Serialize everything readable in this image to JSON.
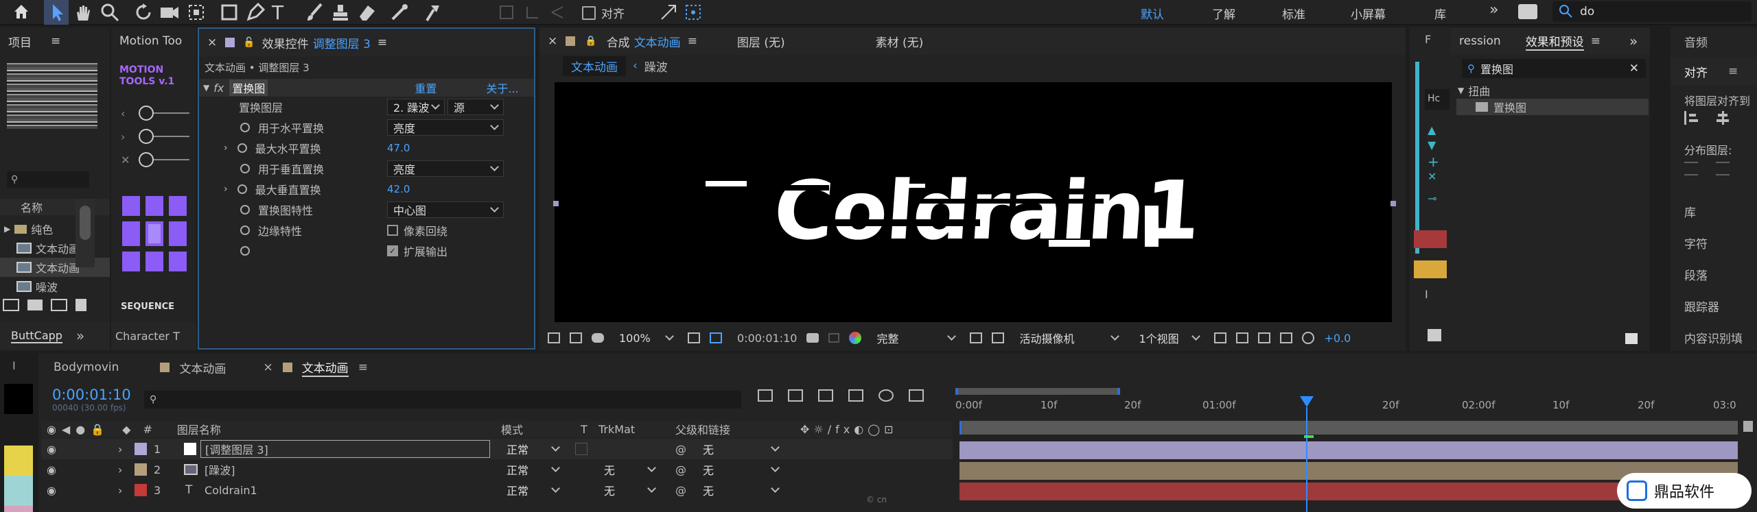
{
  "toolbar": {
    "align_checkbox": "对齐",
    "workspaces": [
      "默认",
      "了解",
      "标准",
      "小屏幕",
      "库"
    ],
    "search_value": "do",
    "overflow": "»"
  },
  "project": {
    "title": "项目",
    "motion_title": "Motion Too",
    "motion_logo_line1": "MOTION",
    "motion_logo_line2": "TOOLS v.1",
    "sequence_label": "SEQUENCE",
    "name_column": "名称",
    "items": [
      {
        "label": "纯色"
      },
      {
        "label": "文本动画"
      },
      {
        "label": "文本动画"
      },
      {
        "label": "噪波"
      }
    ],
    "bottom_tabs": [
      "ButtCapp",
      "Character T"
    ]
  },
  "effect_controls": {
    "title_prefix": "效果控件",
    "title_layer": "调整图层 3",
    "subtitle": "文本动画 • 调整图层 3",
    "fx_label": "fx",
    "effect_name": "置换图",
    "reset": "重置",
    "about": "关于...",
    "props": [
      {
        "label": "置换图层",
        "value1": "2. 躁波",
        "value2": "源"
      },
      {
        "label": "用于水平置换",
        "value": "亮度"
      },
      {
        "label": "最大水平置换",
        "value": "47.0"
      },
      {
        "label": "用于垂直置换",
        "value": "亮度"
      },
      {
        "label": "最大垂直置换",
        "value": "42.0"
      },
      {
        "label": "置换图特性",
        "value": "中心图"
      },
      {
        "label": "边缘特性",
        "checkbox": "像素回绕"
      },
      {
        "label": "",
        "checkbox": "扩展输出"
      }
    ]
  },
  "composition": {
    "tab_prefix": "合成",
    "tab_name": "文本动画",
    "layer_tab": "图层  (无)",
    "footage_tab": "素材  (无)",
    "breadcrumb_active": "文本动画",
    "breadcrumb_next": "躁波",
    "canvas_text": "Coldrain1",
    "zoom": "100%",
    "timecode": "0:00:01:10",
    "quality": "完整",
    "camera": "活动摄像机",
    "views": "1个视图",
    "exposure": "+0.0"
  },
  "effects_presets": {
    "left_tab": "ression",
    "title": "效果和预设",
    "search": "置换图",
    "category": "扭曲",
    "result": "置换图"
  },
  "right_panels": {
    "audio": "音频",
    "align": "对齐",
    "align_to": "将图层对齐到",
    "distribute": "分布图层:",
    "items": [
      "库",
      "字符",
      "段落",
      "跟踪器",
      "内容识别填"
    ]
  },
  "timeline": {
    "tabs": [
      {
        "label": "Bodymovin"
      },
      {
        "label": "文本动画"
      },
      {
        "label": "文本动画"
      }
    ],
    "timecode": "0:00:01:10",
    "fps": "00040 (30.00 fps)",
    "columns": {
      "name": "图层名称",
      "mode": "模式",
      "t": "T",
      "trkmat": "TrkMat",
      "parent": "父级和链接"
    },
    "ruler": [
      "0:00f",
      "10f",
      "20f",
      "01:00f",
      "",
      "20f",
      "02:00f",
      "10f",
      "20f",
      "03:0"
    ],
    "layers": [
      {
        "num": "1",
        "name": "[调整图层 3]",
        "mode": "正常",
        "trkmat": "",
        "parent": "无",
        "color": "#b0a7d8",
        "bar": "#9e97c2"
      },
      {
        "num": "2",
        "name": "[躁波]",
        "mode": "正常",
        "trkmat": "无",
        "parent": "无",
        "color": "#b59f7b",
        "bar": "#8b7b64"
      },
      {
        "num": "3",
        "name": "Coldrain1",
        "mode": "正常",
        "trkmat": "无",
        "parent": "无",
        "color": "#c63a3a",
        "bar": "#9e3a3a"
      }
    ]
  },
  "watermark": {
    "text": "鼎品软件",
    "small": "© cn"
  }
}
